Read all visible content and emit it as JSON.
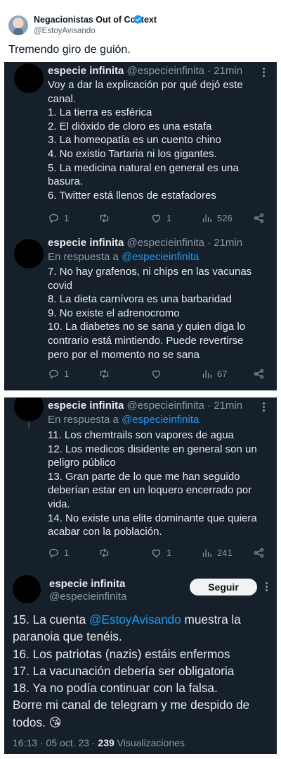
{
  "outer": {
    "name": "Negacionistas Out of Context",
    "handle": "@EstoyAvisando",
    "text": "Tremendo giro de guión."
  },
  "thread": {
    "author_name": "especie infinita",
    "author_handle": "@especieinfinita",
    "time_sep": " · ",
    "time": "21min",
    "reply_prefix": "En respuesta a ",
    "reply_mention": "@especieinfinita"
  },
  "tweet1": {
    "lines": [
      "Voy a dar la explicación por qué dejó este",
      "canal.",
      "1. La tierra es esférica",
      "2. El dióxido de cloro es una estafa",
      "3. La homeopatía es un cuento chino",
      "4. No existio Tartaria ni los gigantes.",
      "5. La medicina natural en general es una",
      "basura.",
      "6. Twitter está llenos de estafadores"
    ],
    "replies": "1",
    "retweets": "",
    "likes": "1",
    "views": "526"
  },
  "tweet2": {
    "lines": [
      "7. No hay grafenos, ni chips en las vacunas",
      "covid",
      "8. La dieta carnívora es una barbaridad",
      "9. No existe el adrenocromo",
      "10. La diabetes no se sana y quien diga lo",
      "contrario está mintiendo. Puede revertirse",
      "pero por el momento no se sana"
    ],
    "replies": "1",
    "retweets": "",
    "likes": "",
    "views": "67"
  },
  "tweet3": {
    "lines": [
      "11. Los chemtrails son vapores de agua",
      "12. Los medicos disidente en general son un",
      "peligro público",
      "13. Gran parte de lo que me han seguido",
      "deberían estar en un loquero encerrado por",
      "vida.",
      "14. No existe una elite dominante que quiera",
      "acabar con la población."
    ],
    "replies": "1",
    "retweets": "",
    "likes": "1",
    "views": "241"
  },
  "tweet4": {
    "follow_label": "Seguir",
    "line1_prefix": "15. La cuenta ",
    "line1_mention": "@EstoyAvisando",
    "line1_suffix": " muestra la",
    "lines": [
      "paranoia que tenéis.",
      "16. Los patriotas (nazis) estáis enfermos",
      "17. La vacunación debería ser obligatoria",
      "18. Ya no podía continuar con la falsa.",
      "Borre mi canal de telegram y me despido de",
      "todos. 😘"
    ],
    "timestamp": "16:13 · 05 oct. 23 · ",
    "views_count": "239",
    "views_label": " Visualizaciones"
  },
  "icons": {
    "reply": "reply-icon",
    "retweet": "retweet-icon",
    "like": "like-icon",
    "views": "views-icon",
    "share": "share-icon",
    "more": "more-icon",
    "verified": "verified-badge-icon"
  },
  "colors": {
    "dark_bg": "#15202b",
    "link": "#1d9bf0",
    "muted": "#8b98a5",
    "verified": "#1d9bf0"
  }
}
